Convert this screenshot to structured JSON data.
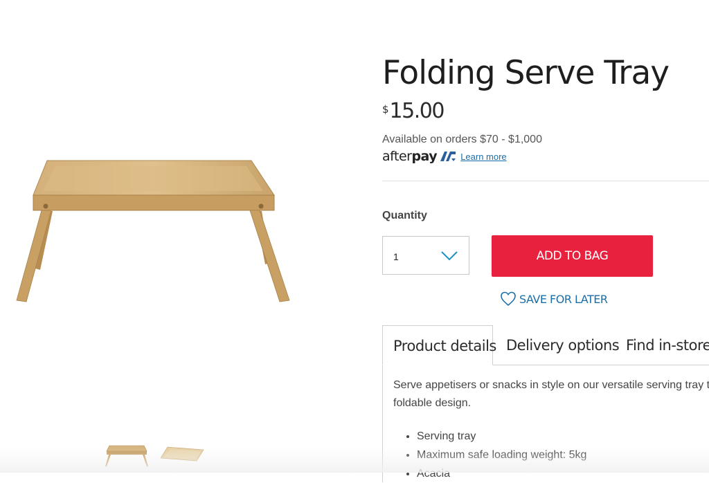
{
  "product": {
    "title": "Folding Serve Tray",
    "currency_symbol": "$",
    "price": "15.00"
  },
  "afterpay": {
    "availability": "Available on orders $70 - $1,000",
    "brand_regular": "after",
    "brand_bold": "pay",
    "learn_more": "Learn more"
  },
  "quantity": {
    "label": "Quantity",
    "selected": "1"
  },
  "actions": {
    "add_to_bag": "ADD TO BAG",
    "save_for_later": "SAVE FOR LATER"
  },
  "tabs": [
    {
      "label": "Product details",
      "active": true
    },
    {
      "label": "Delivery options",
      "active": false
    },
    {
      "label": "Find in-store",
      "active": false
    }
  ],
  "details": {
    "description": "Serve appetisers or snacks in style on our versatile serving tray th foldable design.",
    "features": [
      "Serving tray",
      "Maximum safe loading weight: 5kg",
      "Acacia"
    ]
  },
  "gallery": {
    "thumbnails": [
      "tray-standing-view",
      "tray-folded-view"
    ]
  },
  "colors": {
    "add_button": "#e8213f",
    "link_blue": "#1a6ea8",
    "wood": "#c9a46c"
  }
}
